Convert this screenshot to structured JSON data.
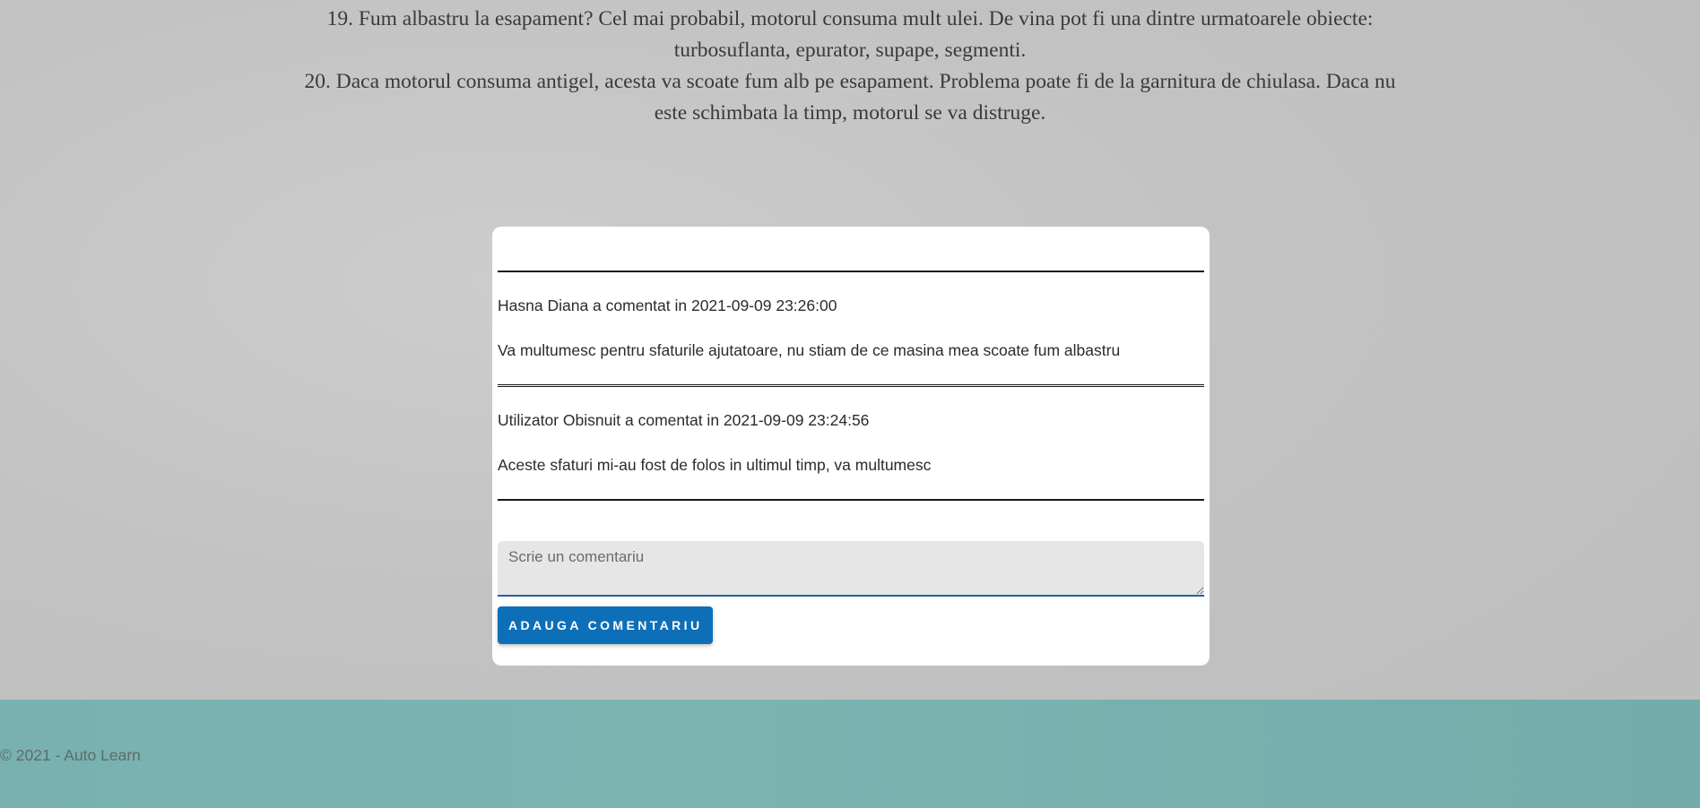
{
  "article": {
    "item19_line1": "19. Fum albastru la esapament? Cel mai probabil, motorul consuma mult ulei. De vina pot fi una dintre urmatoarele obiecte:",
    "item19_line2": "turbosuflanta, epurator, supape, segmenti.",
    "item20_line1": "20. Daca motorul consuma antigel, acesta va scoate fum alb pe esapament. Problema poate fi de la garnitura de chiulasa. Daca nu",
    "item20_line2": "este schimbata la timp, motorul se va distruge."
  },
  "comments": [
    {
      "meta": "Hasna Diana a comentat in 2021-09-09 23:26:00",
      "body": "Va multumesc pentru sfaturile ajutatoare, nu stiam de ce masina mea scoate fum albastru"
    },
    {
      "meta": "Utilizator Obisnuit a comentat in 2021-09-09 23:24:56",
      "body": "Aceste sfaturi mi-au fost de folos in ultimul timp, va multumesc"
    }
  ],
  "comment_form": {
    "placeholder": "Scrie un comentariu",
    "value": "",
    "submit_label": "ADAUGA COMENTARIU",
    "submit_color": "#0d6fb8"
  },
  "footer": {
    "text": "© 2021 - Auto Learn",
    "color": "#78b1b0"
  }
}
